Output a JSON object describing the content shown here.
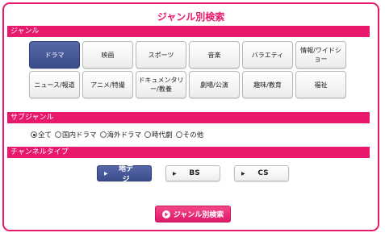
{
  "title": "ジャンル別検索",
  "sections": {
    "genre": "ジャンル",
    "subgenre": "サブジャンル",
    "channel_type": "チャンネルタイプ"
  },
  "genres": [
    {
      "label": "ドラマ",
      "selected": true
    },
    {
      "label": "映画",
      "selected": false
    },
    {
      "label": "スポーツ",
      "selected": false
    },
    {
      "label": "音楽",
      "selected": false
    },
    {
      "label": "バラエティ",
      "selected": false
    },
    {
      "label": "情報/ワイドショー",
      "selected": false
    },
    {
      "label": "ニュース/報道",
      "selected": false
    },
    {
      "label": "アニメ/特撮",
      "selected": false
    },
    {
      "label": "ドキュメンタリー/教養",
      "selected": false
    },
    {
      "label": "劇場/公演",
      "selected": false
    },
    {
      "label": "趣味/教育",
      "selected": false
    },
    {
      "label": "福祉",
      "selected": false
    }
  ],
  "subgenres": [
    {
      "label": "全て",
      "checked": true
    },
    {
      "label": "国内ドラマ",
      "checked": false
    },
    {
      "label": "海外ドラマ",
      "checked": false
    },
    {
      "label": "時代劇",
      "checked": false
    },
    {
      "label": "その他",
      "checked": false
    }
  ],
  "channels": [
    {
      "label": "地デジ",
      "selected": true
    },
    {
      "label": "BS",
      "selected": false
    },
    {
      "label": "CS",
      "selected": false
    }
  ],
  "search_button": "ジャンル別検索",
  "colors": {
    "accent": "#e8196c",
    "selected": "#3a4c8a"
  }
}
